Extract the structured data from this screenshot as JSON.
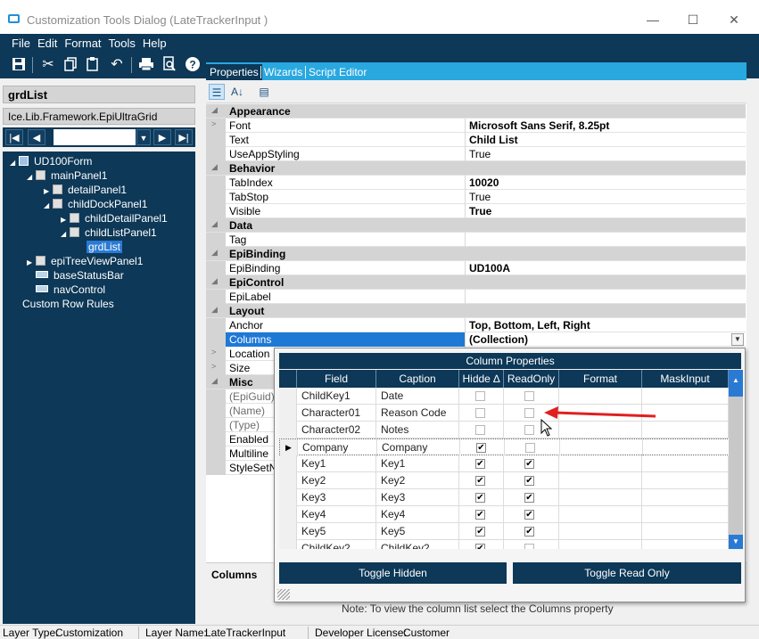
{
  "window": {
    "title": "Customization Tools Dialog  (LateTrackerInput )",
    "minimize_icon": "minimize-icon",
    "maximize_icon": "maximize-icon",
    "close_icon": "close-icon"
  },
  "menu": [
    "File",
    "Edit",
    "Format",
    "Tools",
    "Help"
  ],
  "toolbar": [
    "save-icon",
    "cut-icon",
    "copy-icon",
    "paste-icon",
    "undo-icon",
    "print-icon",
    "print-preview-icon",
    "help-icon"
  ],
  "left": {
    "control_name": "grdList",
    "control_type": "Ice.Lib.Framework.EpiUltraGrid",
    "tree": [
      {
        "label": "UD100Form"
      },
      {
        "label": "mainPanel1"
      },
      {
        "label": "detailPanel1"
      },
      {
        "label": "childDockPanel1"
      },
      {
        "label": "childDetailPanel1"
      },
      {
        "label": "childListPanel1"
      },
      {
        "label": "grdList"
      },
      {
        "label": "epiTreeViewPanel1"
      },
      {
        "label": "baseStatusBar"
      },
      {
        "label": "navControl"
      },
      {
        "label": "Custom Row Rules"
      }
    ]
  },
  "tabs": [
    "Properties",
    "Wizards",
    "Script Editor"
  ],
  "properties": [
    {
      "name": "Appearance",
      "value": ""
    },
    {
      "name": "Font",
      "value": "Microsoft Sans Serif, 8.25pt"
    },
    {
      "name": "Text",
      "value": "Child List"
    },
    {
      "name": "UseAppStyling",
      "value": "True"
    },
    {
      "name": "Behavior",
      "value": ""
    },
    {
      "name": "TabIndex",
      "value": "10020"
    },
    {
      "name": "TabStop",
      "value": "True"
    },
    {
      "name": "Visible",
      "value": "True"
    },
    {
      "name": "Data",
      "value": ""
    },
    {
      "name": "Tag",
      "value": ""
    },
    {
      "name": "EpiBinding",
      "value": ""
    },
    {
      "name": "EpiBinding",
      "value": "UD100A"
    },
    {
      "name": "EpiControl",
      "value": ""
    },
    {
      "name": "EpiLabel",
      "value": ""
    },
    {
      "name": "Layout",
      "value": ""
    },
    {
      "name": "Anchor",
      "value": "Top, Bottom, Left, Right"
    },
    {
      "name": "Columns",
      "value": "(Collection)"
    },
    {
      "name": "Location",
      "value": ""
    },
    {
      "name": "Size",
      "value": ""
    },
    {
      "name": "Misc",
      "value": ""
    },
    {
      "name": "(EpiGuid)",
      "value": ""
    },
    {
      "name": "(Name)",
      "value": ""
    },
    {
      "name": "(Type)",
      "value": ""
    },
    {
      "name": "Enabled",
      "value": ""
    },
    {
      "name": "Multiline",
      "value": ""
    },
    {
      "name": "StyleSetNa",
      "value": ""
    }
  ],
  "description": {
    "title": "Columns",
    "note": "Note:  To view the column list select the Columns property"
  },
  "column_properties": {
    "title": "Column Properties",
    "headers": [
      "Field",
      "Caption",
      "Hidde ∆",
      "ReadOnly",
      "Format",
      "MaskInput"
    ],
    "rows": [
      {
        "field": "ChildKey1",
        "caption": "Date",
        "hidden": false,
        "readonly": false
      },
      {
        "field": "Character01",
        "caption": "Reason Code",
        "hidden": false,
        "readonly": false
      },
      {
        "field": "Character02",
        "caption": "Notes",
        "hidden": false,
        "readonly": false
      },
      {
        "field": "Company",
        "caption": "Company",
        "hidden": true,
        "readonly": false
      },
      {
        "field": "Key1",
        "caption": "Key1",
        "hidden": true,
        "readonly": true
      },
      {
        "field": "Key2",
        "caption": "Key2",
        "hidden": true,
        "readonly": true
      },
      {
        "field": "Key3",
        "caption": "Key3",
        "hidden": true,
        "readonly": true
      },
      {
        "field": "Key4",
        "caption": "Key4",
        "hidden": true,
        "readonly": true
      },
      {
        "field": "Key5",
        "caption": "Key5",
        "hidden": true,
        "readonly": true
      },
      {
        "field": "ChildKey2",
        "caption": "ChildKey2",
        "hidden": true,
        "readonly": false
      }
    ],
    "toggle_hidden": "Toggle Hidden",
    "toggle_readonly": "Toggle Read Only"
  },
  "status": {
    "layer_type_label": "Layer Type:",
    "layer_type": "Customization",
    "layer_name_label": "Layer Name:",
    "layer_name": "LateTrackerInput",
    "license_label": "Developer License:",
    "license": "Customer"
  },
  "colors": {
    "navy": "#0d3857",
    "tab_strip": "#29a8e0",
    "selection": "#1e78d6",
    "annotation_arrow": "#e02020"
  }
}
